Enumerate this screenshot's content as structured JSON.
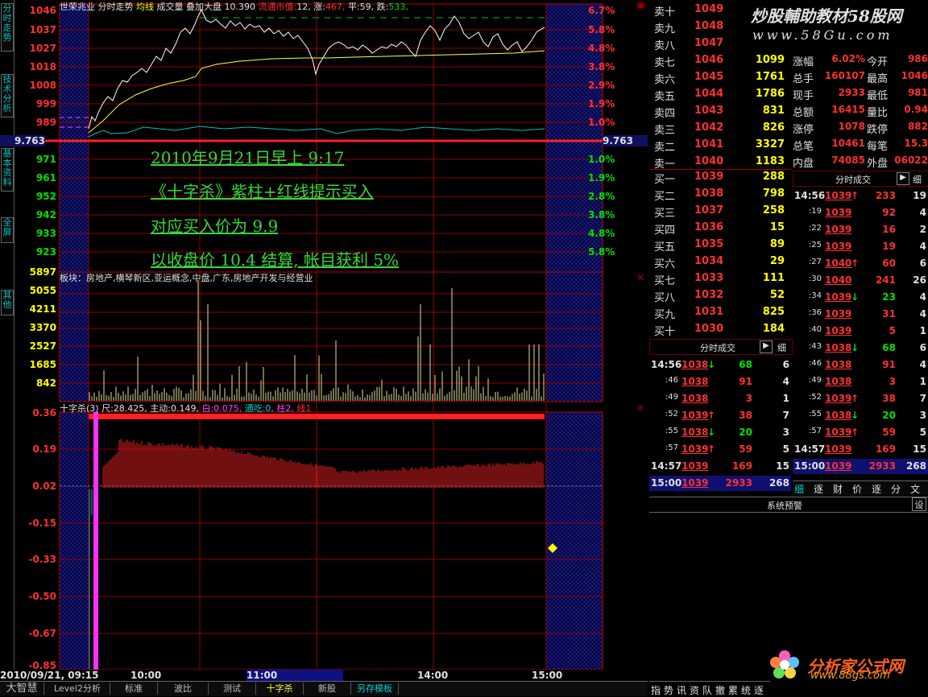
{
  "left_tabs": [
    "分时走势",
    "技术分析",
    "基本资料",
    "全屏",
    "其他"
  ],
  "header": {
    "stock": "世荣兆业",
    "mode": "分时走势",
    "avg": "均线",
    "vol": "成交量",
    "overlay": "叠加大盘",
    "price": "10.390",
    "market_cap_label": "流通市值:",
    "market_cap": "12,",
    "up_label": "涨:",
    "up": "467,",
    "flat_label": "平:",
    "flat": "59,",
    "down_label": "跌:",
    "down": "533,"
  },
  "price_axis_left": [
    "1046",
    "1037",
    "1027",
    "1018",
    "1008",
    "999",
    "989",
    "9.763",
    "971",
    "961",
    "952",
    "942",
    "933",
    "923"
  ],
  "price_axis_right": [
    "6.7%",
    "5.8%",
    "4.8%",
    "3.8%",
    "2.9%",
    "1.9%",
    "1.0%",
    "9.763",
    "1.0%",
    "1.9%",
    "2.8%",
    "3.8%",
    "4.8%",
    "5.8%"
  ],
  "annotations": [
    "2010年9月21日早上 9:17",
    "《十字杀》紫柱+红线提示买入",
    "对应买入价为 9.9",
    "以收盘价 10.4 结算, 帐目获利 5%"
  ],
  "sector": "板块：房地产,横琴新区,亚运概念,中盘,广东,房地产开发与经营业",
  "volume_axis": [
    "5897",
    "5055",
    "4211",
    "3370",
    "2527",
    "1685",
    "842"
  ],
  "indicator_header": {
    "name": "十字杀(3)",
    "v1": "尺:28.425,",
    "v2": "主动:0.149,",
    "v3": "白:0.075,",
    "v4": "通吃:0,",
    "v5": "柱2,",
    "v6": "线1"
  },
  "indicator_axis": [
    "0.36",
    "0.19",
    "0.02",
    "-0.15",
    "-0.33",
    "-0.50",
    "-0.67",
    "-0.85"
  ],
  "time_axis": {
    "date": "2010/09/21, 09:15",
    "t1": "10:00",
    "t2": "11:00",
    "t3": "14:00",
    "t4": "15:00"
  },
  "bottom_tabs": [
    "大智慧",
    "Level2分析",
    "标准",
    "波比",
    "测试",
    "十字杀",
    "新股",
    "另存模板"
  ],
  "asks": [
    {
      "label": "卖十",
      "price": "1049",
      "vol": ""
    },
    {
      "label": "卖九",
      "price": "1048",
      "vol": ""
    },
    {
      "label": "卖八",
      "price": "1047",
      "vol": ""
    },
    {
      "label": "卖七",
      "price": "1046",
      "vol": "1099"
    },
    {
      "label": "卖六",
      "price": "1045",
      "vol": "1761"
    },
    {
      "label": "卖五",
      "price": "1044",
      "vol": "1786"
    },
    {
      "label": "卖四",
      "price": "1043",
      "vol": "831"
    },
    {
      "label": "卖三",
      "price": "1042",
      "vol": "826"
    },
    {
      "label": "卖二",
      "price": "1041",
      "vol": "3327"
    },
    {
      "label": "卖一",
      "price": "1040",
      "vol": "1183"
    }
  ],
  "bids": [
    {
      "label": "买一",
      "price": "1039",
      "vol": "288"
    },
    {
      "label": "买二",
      "price": "1038",
      "vol": "798"
    },
    {
      "label": "买三",
      "price": "1037",
      "vol": "258"
    },
    {
      "label": "买四",
      "price": "1036",
      "vol": "15"
    },
    {
      "label": "买五",
      "price": "1035",
      "vol": "89"
    },
    {
      "label": "买六",
      "price": "1034",
      "vol": "29"
    },
    {
      "label": "买七",
      "price": "1033",
      "vol": "111"
    },
    {
      "label": "买八",
      "price": "1032",
      "vol": "52"
    },
    {
      "label": "买九",
      "price": "1031",
      "vol": "825"
    },
    {
      "label": "买十",
      "price": "1030",
      "vol": "184"
    }
  ],
  "watermark_top": "炒股輔助教材58股网",
  "watermark_url": "www.58Gu.com",
  "stats": [
    {
      "k": "涨幅",
      "v": "6.02%",
      "k2": "今开",
      "v2": "986"
    },
    {
      "k": "总手",
      "v": "160107",
      "k2": "最高",
      "v2": "1046"
    },
    {
      "k": "现手",
      "v": "2933",
      "k2": "最低",
      "v2": "981"
    },
    {
      "k": "总额",
      "v": "16415",
      "k2": "量比",
      "v2": "0.94"
    },
    {
      "k": "涨停",
      "v": "1078",
      "k2": "跌停",
      "v2": "882"
    },
    {
      "k": "总笔",
      "v": "10461",
      "k2": "每笔",
      "v2": "15.3"
    },
    {
      "k": "内盘",
      "v": "74085",
      "k2": "外盘",
      "v2": "06022"
    }
  ],
  "ticks_right": {
    "title": "分时成交",
    "rows": [
      {
        "t": "14:56",
        "p": "1039",
        "a": "↑",
        "v": "233",
        "n": "19"
      },
      {
        "t": ":19",
        "p": "1039",
        "a": "",
        "v": "92",
        "n": "4"
      },
      {
        "t": ":22",
        "p": "1039",
        "a": "",
        "v": "16",
        "n": "2"
      },
      {
        "t": ":25",
        "p": "1039",
        "a": "",
        "v": "19",
        "n": "4"
      },
      {
        "t": ":27",
        "p": "1040",
        "a": "↑",
        "v": "60",
        "n": "6"
      },
      {
        "t": ":30",
        "p": "1040",
        "a": "",
        "v": "241",
        "n": "26"
      },
      {
        "t": ":34",
        "p": "1039",
        "a": "↓",
        "v": "23",
        "n": "4"
      },
      {
        "t": ":36",
        "p": "1039",
        "a": "",
        "v": "31",
        "n": "4"
      },
      {
        "t": ":40",
        "p": "1039",
        "a": "",
        "v": "5",
        "n": "1"
      },
      {
        "t": ":43",
        "p": "1038",
        "a": "↓",
        "v": "68",
        "n": "6"
      },
      {
        "t": ":46",
        "p": "1038",
        "a": "",
        "v": "91",
        "n": "4"
      },
      {
        "t": ":49",
        "p": "1038",
        "a": "",
        "v": "3",
        "n": "1"
      },
      {
        "t": ":52",
        "p": "1039",
        "a": "↑",
        "v": "38",
        "n": "7"
      },
      {
        "t": ":55",
        "p": "1038",
        "a": "↓",
        "v": "20",
        "n": "3"
      },
      {
        "t": ":57",
        "p": "1039",
        "a": "↑",
        "v": "59",
        "n": "5"
      },
      {
        "t": "14:57",
        "p": "1039",
        "a": "",
        "v": "169",
        "n": "15"
      },
      {
        "t": "15:00",
        "p": "1039",
        "a": "",
        "v": "2933",
        "n": "268"
      }
    ]
  },
  "ticks_left": {
    "title": "分时成交",
    "rows": [
      {
        "t": "14:56",
        "p": "1038",
        "a": "↓",
        "v": "68",
        "n": "6"
      },
      {
        "t": ":46",
        "p": "1038",
        "a": "",
        "v": "91",
        "n": "4"
      },
      {
        "t": ":49",
        "p": "1038",
        "a": "",
        "v": "3",
        "n": "1"
      },
      {
        "t": ":52",
        "p": "1039",
        "a": "↑",
        "v": "38",
        "n": "7"
      },
      {
        "t": ":55",
        "p": "1038",
        "a": "↓",
        "v": "20",
        "n": "3"
      },
      {
        "t": ":57",
        "p": "1039",
        "a": "↑",
        "v": "59",
        "n": "5"
      },
      {
        "t": "14:57",
        "p": "1039",
        "a": "",
        "v": "169",
        "n": "15"
      },
      {
        "t": "15:00",
        "p": "1039",
        "a": "",
        "v": "2933",
        "n": "268"
      }
    ]
  },
  "detail_label": "细",
  "func_tabs": [
    "细",
    "逐",
    "财",
    "价",
    "逐",
    "分",
    "文"
  ],
  "alert_title": "系统预警",
  "settings_label": "设",
  "logo_text": "分析家公式网",
  "logo_url": "www.88gs.com",
  "bottom_right_tabs": [
    "指",
    "势",
    "讯",
    "资",
    "队",
    "撤",
    "累",
    "统",
    "逐"
  ]
}
